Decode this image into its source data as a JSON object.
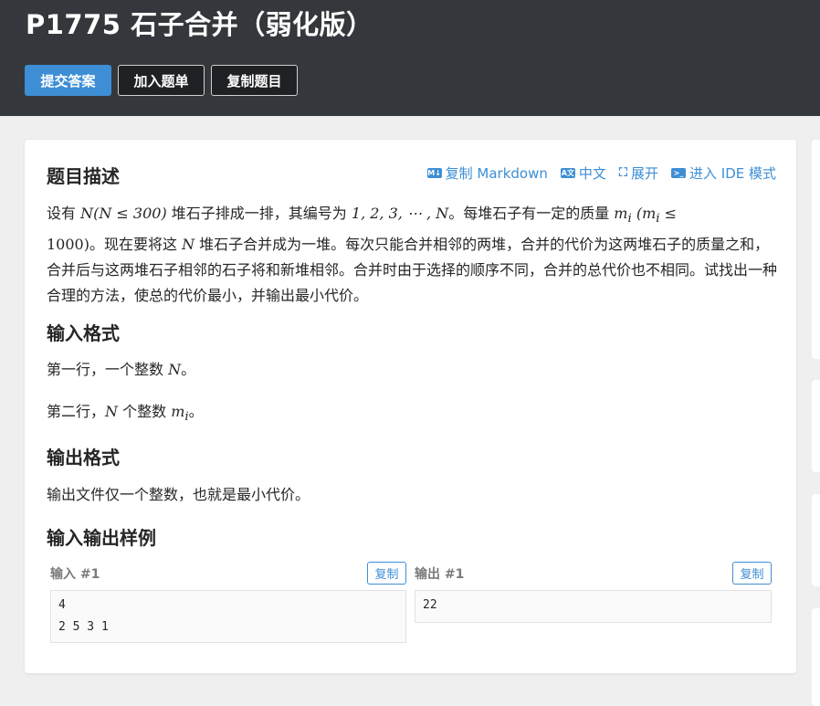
{
  "header": {
    "title": "P1775 石子合并（弱化版）",
    "buttons": {
      "submit": "提交答案",
      "add_list": "加入题单",
      "copy_problem": "复制题目"
    }
  },
  "toolbar": {
    "copy_markdown": "复制 Markdown",
    "language": "中文",
    "expand": "展开",
    "ide": "进入 IDE 模式"
  },
  "sections": {
    "description_title": "题目描述",
    "input_title": "输入格式",
    "output_title": "输出格式",
    "samples_title": "输入输出样例"
  },
  "description": {
    "t1": "设有 ",
    "m1": "N",
    "m2": "(N ≤ 300)",
    "t2": " 堆石子排成一排，其编号为 ",
    "m3": "1, 2, 3, ⋯ , N",
    "t3": "。每堆石子有一定的质量 ",
    "m4": "m",
    "m4sub": "i",
    "m5": "(m",
    "m5sub": "i",
    "m5b": " ≤",
    "m6": "1000)",
    "t4": "。现在要将这 ",
    "m7": "N",
    "t5": " 堆石子合并成为一堆。每次只能合并相邻的两堆，合并的代价为这两堆石子的质量之和，合并后与这两堆石子相邻的石子将和新堆相邻。合并时由于选择的顺序不同，合并的总代价也不相同。试找出一种合理的方法，使总的代价最小，并输出最小代价。"
  },
  "input_format": {
    "line1_text": "第一行，一个整数 ",
    "line1_math": "N",
    "line1_end": "。",
    "line2_text": "第二行，",
    "line2_math": "N",
    "line2_mid": " 个整数 ",
    "line2_math2": "m",
    "line2_sub": "i",
    "line2_end": "。"
  },
  "output_format": {
    "text": "输出文件仅一个整数，也就是最小代价。"
  },
  "samples": {
    "input_label": "输入 #1",
    "output_label": "输出 #1",
    "copy_label": "复制",
    "input_value": "4\n2 5 3 1",
    "output_value": "22"
  },
  "colors": {
    "header_bg": "#34383c",
    "accent": "#3e8ed6",
    "page_bg": "#efefef"
  }
}
